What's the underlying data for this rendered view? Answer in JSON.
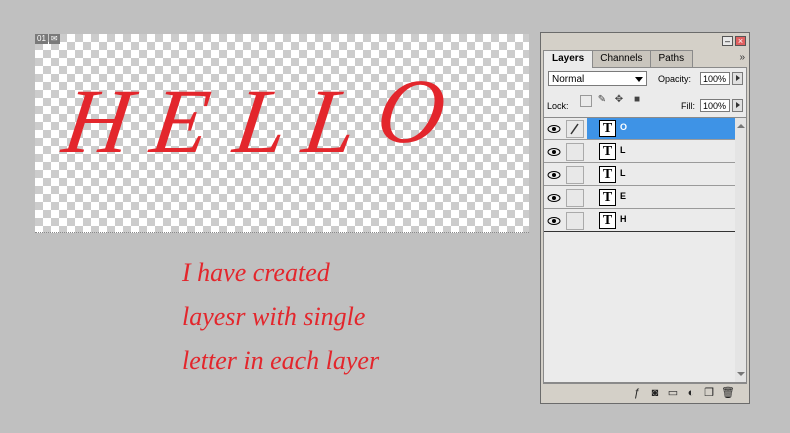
{
  "document": {
    "badge": [
      "01",
      "✉"
    ],
    "artwork_text": [
      "H",
      "E",
      "L",
      "L",
      "O"
    ],
    "caption_lines": [
      "I have created",
      "layesr with single",
      "letter in each layer"
    ],
    "text_color": "#e3262c"
  },
  "layers_panel": {
    "tabs": [
      {
        "label": "Layers",
        "active": true
      },
      {
        "label": "Channels",
        "active": false
      },
      {
        "label": "Paths",
        "active": false
      }
    ],
    "menu_glyph": "»",
    "blend_mode": "Normal",
    "opacity_label": "Opacity:",
    "opacity_value": "100%",
    "lock_label": "Lock:",
    "fill_label": "Fill:",
    "fill_value": "100%",
    "layers": [
      {
        "name": "O",
        "selected": true,
        "thumb": "T"
      },
      {
        "name": "L",
        "selected": false,
        "thumb": "T"
      },
      {
        "name": "L",
        "selected": false,
        "thumb": "T"
      },
      {
        "name": "E",
        "selected": false,
        "thumb": "T"
      },
      {
        "name": "H",
        "selected": false,
        "thumb": "T"
      }
    ],
    "selection_color": "#3e93e6",
    "bottom_icons": [
      "link-icon",
      "layer-style-icon",
      "mask-icon",
      "folder-icon",
      "adjustment-icon",
      "new-layer-icon",
      "trash-icon"
    ]
  }
}
